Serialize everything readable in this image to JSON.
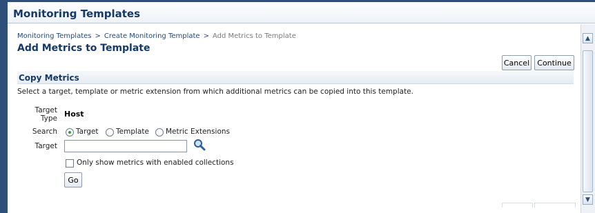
{
  "window": {
    "title": "Monitoring Templates"
  },
  "breadcrumb": {
    "items": [
      "Monitoring Templates",
      "Create Monitoring Template",
      "Add Metrics to Template"
    ],
    "separator": ">"
  },
  "page": {
    "title": "Add Metrics to Template"
  },
  "actions": {
    "cancel_label": "Cancel",
    "continue_label": "Continue"
  },
  "copy_metrics": {
    "heading": "Copy Metrics",
    "description": "Select a target, template or metric extension from which additional metrics can be copied into this template.",
    "target_type_label": "Target Type",
    "target_type_value": "Host",
    "search_label": "Search",
    "search_options": [
      "Target",
      "Template",
      "Metric Extensions"
    ],
    "search_selected": "Target",
    "target_label": "Target",
    "target_value": "",
    "only_enabled_label": "Only show metrics with enabled collections",
    "only_enabled_checked": false,
    "go_label": "Go"
  },
  "icons": {
    "search": "magnifier-icon",
    "scroll_up": "chevron-up-icon",
    "scroll_down": "chevron-down-icon"
  },
  "colors": {
    "title": "#153a68",
    "link": "#234a78",
    "frame": "#2d4f7a",
    "radio_selected": "#3a9b3a"
  }
}
